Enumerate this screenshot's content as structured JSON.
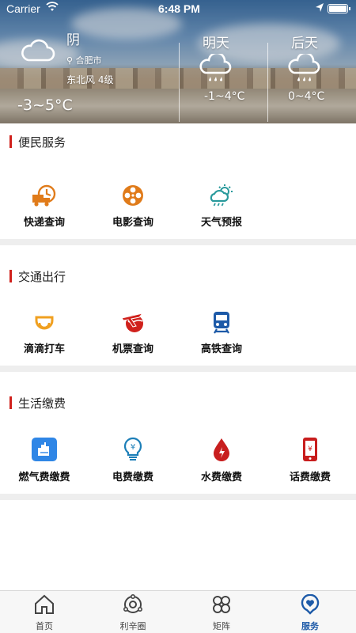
{
  "status_bar": {
    "carrier": "Carrier",
    "time": "6:48 PM"
  },
  "weather": {
    "today": {
      "condition": "阴",
      "city": "合肥市",
      "wind": "东北风 4级",
      "temp": "-3~5°C",
      "icon": "cloud-icon"
    },
    "forecast": [
      {
        "label": "明天",
        "temp": "-1~4°C",
        "icon": "rain-cloud-icon"
      },
      {
        "label": "后天",
        "temp": "0~4°C",
        "icon": "rain-cloud-icon"
      }
    ]
  },
  "sections": [
    {
      "title": "便民服务",
      "items": [
        {
          "label": "快递查询",
          "icon": "delivery-truck-icon",
          "color": "#e07b1a"
        },
        {
          "label": "电影查询",
          "icon": "film-reel-icon",
          "color": "#e07b1a"
        },
        {
          "label": "天气预报",
          "icon": "weather-icon",
          "color": "#2a9a9c"
        }
      ]
    },
    {
      "title": "交通出行",
      "items": [
        {
          "label": "滴滴打车",
          "icon": "didi-icon",
          "color": "#f0a020"
        },
        {
          "label": "机票查询",
          "icon": "airplane-globe-icon",
          "color": "#d0211c"
        },
        {
          "label": "高铁查询",
          "icon": "train-icon",
          "color": "#1d5aa8"
        }
      ]
    },
    {
      "title": "生活缴费",
      "items": [
        {
          "label": "燃气费缴费",
          "icon": "gas-bill-icon",
          "color": "#2f86e6"
        },
        {
          "label": "电费缴费",
          "icon": "electricity-bulb-icon",
          "color": "#1d7fb8"
        },
        {
          "label": "水费缴费",
          "icon": "water-drop-icon",
          "color": "#c81e1e"
        },
        {
          "label": "话费缴费",
          "icon": "phone-bill-icon",
          "color": "#c81e1e"
        }
      ]
    }
  ],
  "tab_bar": {
    "items": [
      {
        "label": "首页",
        "icon": "home-icon",
        "active": false
      },
      {
        "label": "利辛圈",
        "icon": "circle-community-icon",
        "active": false
      },
      {
        "label": "矩阵",
        "icon": "matrix-grid-icon",
        "active": false
      },
      {
        "label": "服务",
        "icon": "service-heart-icon",
        "active": true
      }
    ],
    "active_color": "#1d5aa8"
  },
  "accent_color": "#d0211c"
}
